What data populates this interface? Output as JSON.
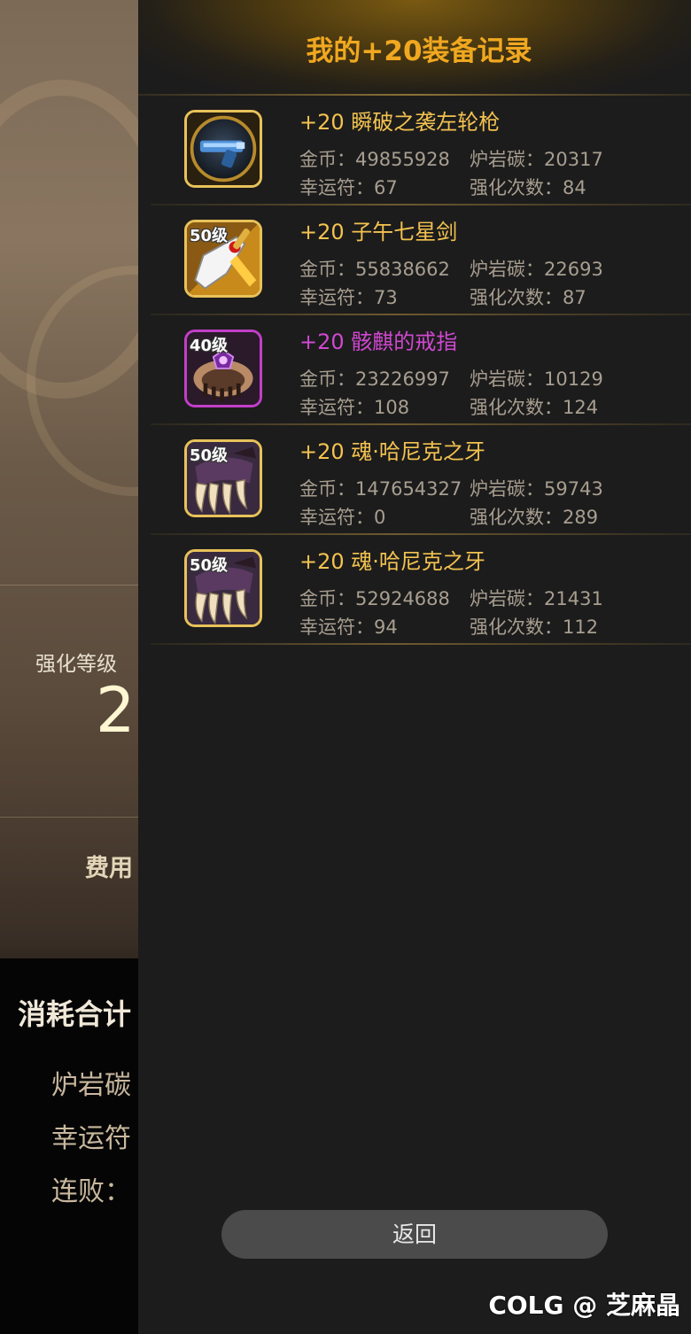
{
  "background": {
    "level_label": "强化等级",
    "level_value": "2",
    "fee_label": "费用",
    "consume_title": "消耗合计",
    "consume_items": [
      "炉岩碳",
      "幸运符",
      "连败："
    ]
  },
  "panel": {
    "title": "我的+20装备记录",
    "labels": {
      "gold": "金币：",
      "carbon": "炉岩碳：",
      "luck": "幸运符：",
      "count": "强化次数："
    },
    "records": [
      {
        "name": "+20 瞬破之袭左轮枪",
        "level_badge": "",
        "icon": "revolver-icon",
        "gold": "49855928",
        "carbon": "20317",
        "luck": "67",
        "count": "84",
        "name_color": "#f3c250"
      },
      {
        "name": "+20 子午七星剑",
        "level_badge": "50级",
        "icon": "sword-icon",
        "gold": "55838662",
        "carbon": "22693",
        "luck": "73",
        "count": "87",
        "name_color": "#f3c250"
      },
      {
        "name": "+20 骸麒的戒指",
        "level_badge": "40级",
        "icon": "ring-icon",
        "gold": "23226997",
        "carbon": "10129",
        "luck": "108",
        "count": "124",
        "name_color": "#d048d0"
      },
      {
        "name": "+20 魂·哈尼克之牙",
        "level_badge": "50级",
        "icon": "claw-icon",
        "gold": "147654327",
        "carbon": "59743",
        "luck": "0",
        "count": "289",
        "name_color": "#f3c250"
      },
      {
        "name": "+20 魂·哈尼克之牙",
        "level_badge": "50级",
        "icon": "claw-icon",
        "gold": "52924688",
        "carbon": "21431",
        "luck": "94",
        "count": "112",
        "name_color": "#f3c250"
      }
    ],
    "back_label": "返回"
  },
  "watermark": "COLG @ 芝麻晶",
  "colors": {
    "title": "#f0a820",
    "item_gold": "#f3c250",
    "item_purple": "#d048d0",
    "panel_bg": "#1c1c1c"
  }
}
